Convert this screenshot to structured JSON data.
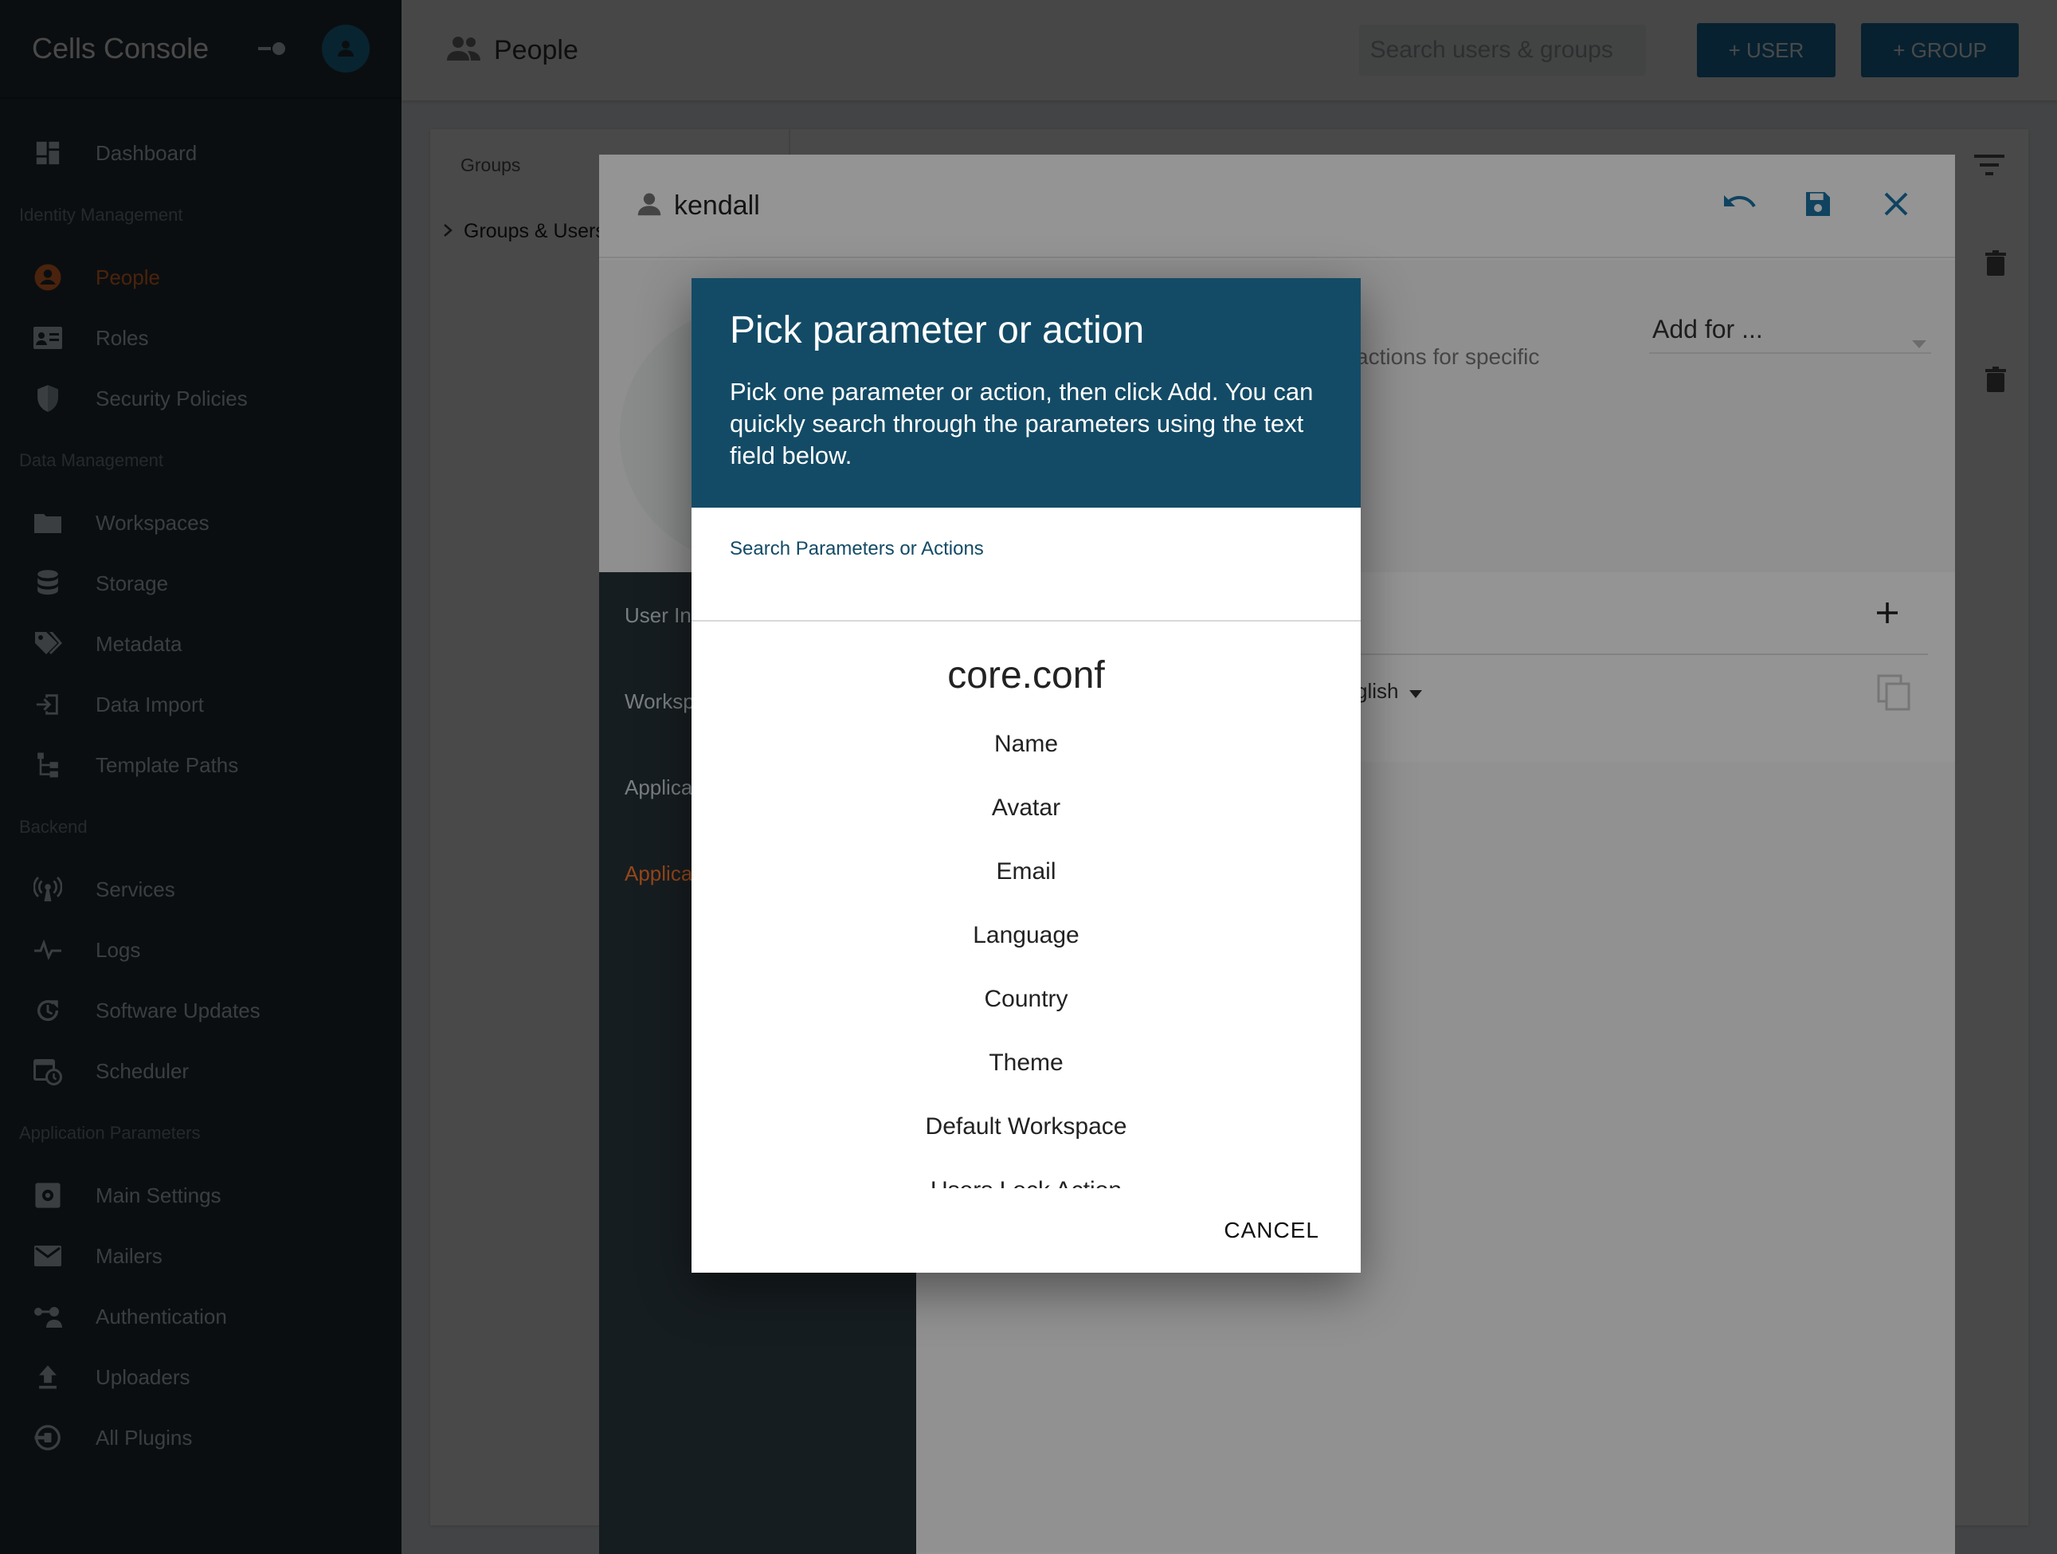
{
  "colors": {
    "sidebar_bg": "#263238",
    "accent_orange": "#ff7a2f",
    "primary_blue": "#1b74a6",
    "dialog_header": "#134b66"
  },
  "app": {
    "title": "Cells Console"
  },
  "sidebar": {
    "items": [
      {
        "type": "item",
        "label": "Dashboard",
        "icon": "dashboard-icon"
      },
      {
        "type": "section",
        "label": "Identity Management"
      },
      {
        "type": "item",
        "label": "People",
        "icon": "person-icon",
        "active": true
      },
      {
        "type": "item",
        "label": "Roles",
        "icon": "id-card-icon"
      },
      {
        "type": "item",
        "label": "Security Policies",
        "icon": "shield-icon"
      },
      {
        "type": "section",
        "label": "Data Management"
      },
      {
        "type": "item",
        "label": "Workspaces",
        "icon": "folder-icon"
      },
      {
        "type": "item",
        "label": "Storage",
        "icon": "database-icon"
      },
      {
        "type": "item",
        "label": "Metadata",
        "icon": "tag-icon"
      },
      {
        "type": "item",
        "label": "Data Import",
        "icon": "import-icon"
      },
      {
        "type": "item",
        "label": "Template Paths",
        "icon": "tree-icon"
      },
      {
        "type": "section",
        "label": "Backend"
      },
      {
        "type": "item",
        "label": "Services",
        "icon": "antenna-icon"
      },
      {
        "type": "item",
        "label": "Logs",
        "icon": "pulse-icon"
      },
      {
        "type": "item",
        "label": "Software Updates",
        "icon": "update-icon"
      },
      {
        "type": "item",
        "label": "Scheduler",
        "icon": "calendar-clock-icon"
      },
      {
        "type": "section",
        "label": "Application Parameters"
      },
      {
        "type": "item",
        "label": "Main Settings",
        "icon": "settings-box-icon"
      },
      {
        "type": "item",
        "label": "Mailers",
        "icon": "mail-icon"
      },
      {
        "type": "item",
        "label": "Authentication",
        "icon": "auth-key-icon"
      },
      {
        "type": "item",
        "label": "Uploaders",
        "icon": "upload-icon"
      },
      {
        "type": "item",
        "label": "All Plugins",
        "icon": "plugin-icon"
      }
    ]
  },
  "topbar": {
    "title": "People",
    "search_placeholder": "Search users & groups",
    "user_button": "+ USER",
    "group_button": "+ GROUP"
  },
  "groups_panel": {
    "label": "Groups",
    "tree_root": "Groups & Users"
  },
  "user_editor": {
    "username": "kendall",
    "add_for": "Add for ...",
    "description_fragment": "actions for specific",
    "language_fragment": "glish",
    "tabs": [
      "User Info",
      "Workspaces",
      "Application Parameters",
      "Application Parameters"
    ],
    "tabs_visible": [
      "User In",
      "Worksp",
      "Applica",
      "Applica"
    ]
  },
  "dialog": {
    "title": "Pick parameter or action",
    "description": "Pick one parameter or action, then click Add. You can quickly search through the parameters using the text field below.",
    "search_label": "Search Parameters or Actions",
    "group": "core.conf",
    "items": [
      "Name",
      "Avatar",
      "Email",
      "Language",
      "Country",
      "Theme",
      "Default Workspace",
      "Users Lock Action"
    ],
    "cancel": "CANCEL"
  }
}
